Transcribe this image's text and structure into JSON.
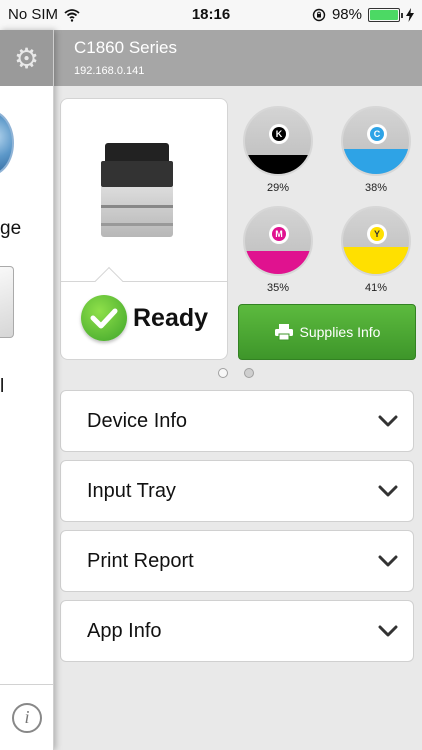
{
  "status_bar": {
    "carrier": "No SIM",
    "time": "18:16",
    "battery": "98%"
  },
  "sidebar": {
    "label1": "ge",
    "label2": "l"
  },
  "header": {
    "title": "C1860 Series",
    "ip": "192.168.0.141"
  },
  "printer": {
    "status": "Ready"
  },
  "toners": [
    {
      "letter": "K",
      "percent": "29%",
      "level": 0.29,
      "color": "#000000"
    },
    {
      "letter": "C",
      "percent": "38%",
      "level": 0.38,
      "color": "#2ea3e6"
    },
    {
      "letter": "M",
      "percent": "35%",
      "level": 0.35,
      "color": "#e0128f"
    },
    {
      "letter": "Y",
      "percent": "41%",
      "level": 0.41,
      "color": "#ffe000"
    }
  ],
  "supplies_button": {
    "label": "Supplies Info"
  },
  "pagination": {
    "current": 1,
    "total": 2
  },
  "accordion": [
    {
      "label": "Device Info"
    },
    {
      "label": "Input Tray"
    },
    {
      "label": "Print Report"
    },
    {
      "label": "App Info"
    }
  ]
}
